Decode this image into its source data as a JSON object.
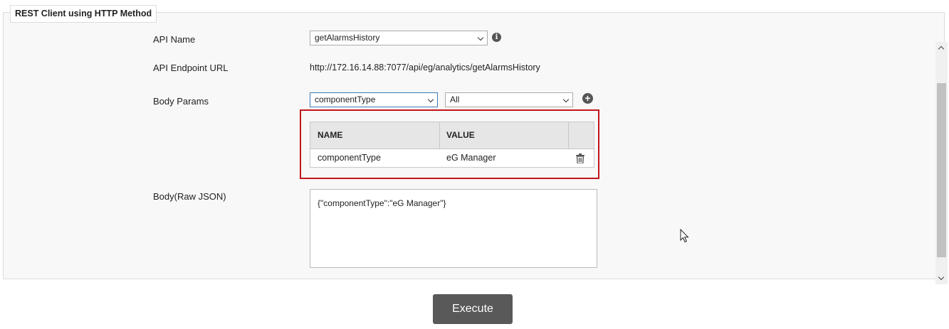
{
  "panel": {
    "title": "REST Client using HTTP Method"
  },
  "form": {
    "api_name": {
      "label": "API Name",
      "value": "getAlarmsHistory"
    },
    "endpoint": {
      "label": "API Endpoint URL",
      "value": "http://172.16.14.88:7077/api/eg/analytics/getAlarmsHistory"
    },
    "body_params": {
      "label": "Body Params",
      "param_select": "componentType",
      "value_select": "All"
    },
    "params_table": {
      "columns": [
        "NAME",
        "VALUE"
      ],
      "rows": [
        {
          "name": "componentType",
          "value": "eG Manager"
        }
      ]
    },
    "raw_json": {
      "label": "Body(Raw JSON)",
      "value": "{\"componentType\":\"eG Manager\"}"
    }
  },
  "actions": {
    "execute_label": "Execute"
  },
  "icons": {
    "info": "info-icon",
    "add": "plus-circle-icon",
    "delete": "trash-icon"
  },
  "colors": {
    "highlight": "#c0161c",
    "button": "#595959",
    "focus": "#3d7bb8"
  }
}
